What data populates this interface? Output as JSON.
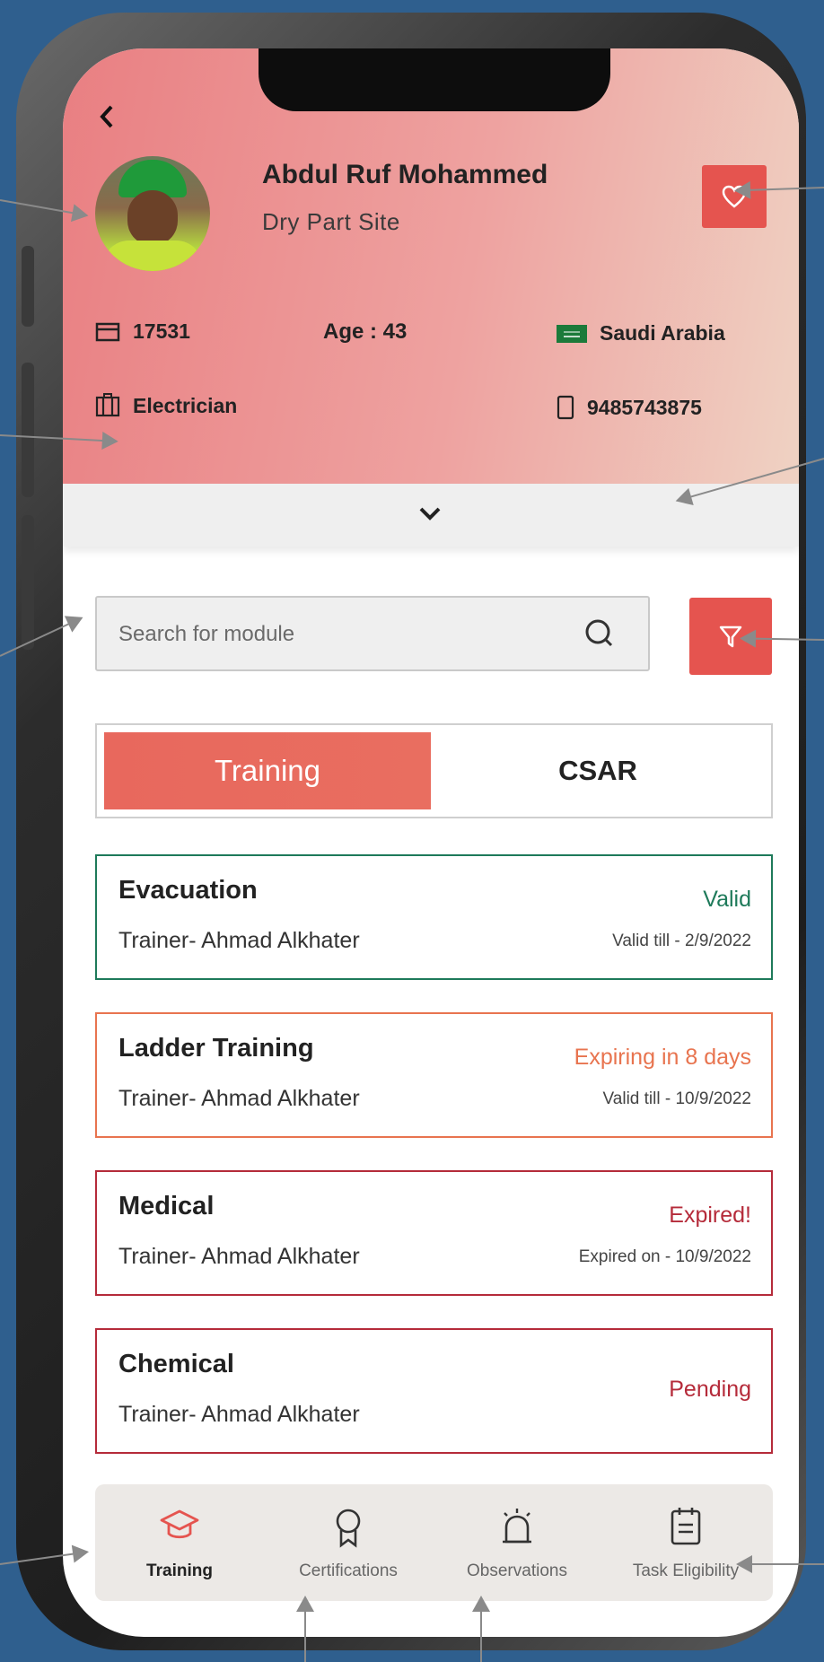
{
  "profile": {
    "back_icon": "back-chevron-icon",
    "name": "Abdul Ruf Mohammed",
    "site": "Dry Part Site",
    "id": "17531",
    "age": "Age : 43",
    "country": "Saudi Arabia",
    "role": "Electrician",
    "phone": "9485743875",
    "favorite_icon": "heart-icon"
  },
  "search": {
    "placeholder": "Search for module"
  },
  "tabs": {
    "training": "Training",
    "csar": "CSAR",
    "selected": "Training"
  },
  "cards": [
    {
      "title": "Evacuation",
      "trainer": "Trainer- Ahmad Alkhater",
      "status": "Valid",
      "date": "Valid till - 2/9/2022",
      "color": "#1e7a5a"
    },
    {
      "title": "Ladder Training",
      "trainer": "Trainer- Ahmad Alkhater",
      "status": "Expiring in 8 days",
      "date": "Valid till - 10/9/2022",
      "color": "#e8744f"
    },
    {
      "title": "Medical",
      "trainer": "Trainer- Ahmad Alkhater",
      "status": "Expired!",
      "date": "Expired on - 10/9/2022",
      "color": "#b52b3a"
    },
    {
      "title": "Chemical",
      "trainer": "Trainer- Ahmad Alkhater",
      "status": "Pending",
      "date": "",
      "color": "#b52b3a"
    }
  ],
  "bottom_nav": [
    {
      "label": "Training",
      "icon": "graduation-cap-icon",
      "active": true
    },
    {
      "label": "Certifications",
      "icon": "award-ribbon-icon",
      "active": false
    },
    {
      "label": "Observations",
      "icon": "observation-bell-icon",
      "active": false
    },
    {
      "label": "Task Eligibility",
      "icon": "clipboard-icon",
      "active": false
    }
  ],
  "colors": {
    "accent": "#e5544f",
    "header_start": "#e97f82",
    "header_end": "#efd2c3",
    "page_bg": "#2f5f8e"
  }
}
